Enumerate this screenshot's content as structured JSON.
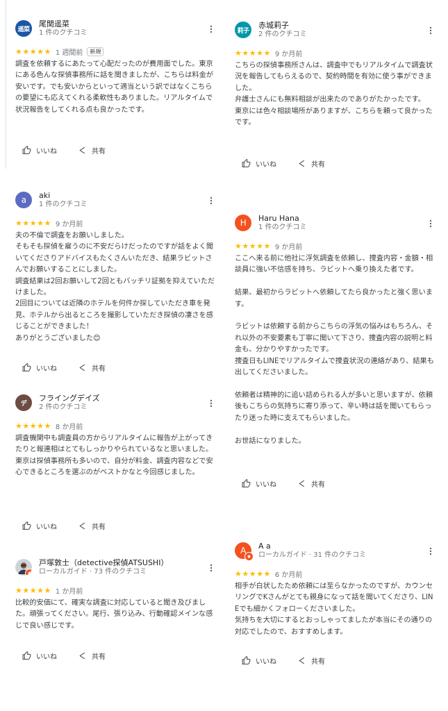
{
  "actions": {
    "like_label": "いいね",
    "share_label": "共有"
  },
  "reviews": [
    {
      "avatar_text": "遥菜",
      "avatar_color": "#1a56a6",
      "name": "尾関遥菜",
      "meta": "1 件のクチコミ",
      "stars": "★★★★★",
      "time": "1 週間前",
      "new_tag": "新規",
      "text": "調査を依頼するにあたって心配だったのが費用面でした。東京にある色んな探偵事務所に話を聞きましたが、こちらは料金が安いです。でも安いからといって適当という訳ではなくこちらの要望にも応えてくれる柔軟性もありました。リアルタイムで状況報告をしてくれる点も良かったです。"
    },
    {
      "avatar_text": "莉子",
      "avatar_color": "#0097a7",
      "name": "赤城莉子",
      "meta": "2 件のクチコミ",
      "stars": "★★★★★",
      "time": "9 か月前",
      "text": "こちらの探偵事務所さんは、調査中でもリアルタイムで調査状況を報告してもらえるので、契約時間を有効に使う事ができました。\n弁護士さんにも無料相談が出来たのでありがたかったです。\n東京には色々相談場所がありますが、こちらを頼って良かったです。"
    },
    {
      "avatar_text": "a",
      "avatar_color": "#5c6bc0",
      "name": "aki",
      "meta": "1 件のクチコミ",
      "stars": "★★★★★",
      "time": "9 か月前",
      "text": "夫の不倫で調査をお願いしました。\nそもそも探偵を雇うのに不安だらけだったのですが話をよく聞いてくださりアドバイスもたくさんいただき、結果ラビットさんでお願いすることにしました。\n調査結果は2回お願いして2回ともバッチリ証拠を抑えていただけました。\n2回目については近隣のホテルを何件か探していただき車を発見、ホテルから出るところを撮影していただき探偵の凄さを感じることができました！\nありがとうございました😊"
    },
    {
      "avatar_text": "H",
      "avatar_color": "#f4511e",
      "name": "Haru Hana",
      "meta": "1 件のクチコミ",
      "stars": "★★★★★",
      "time": "9 か月前",
      "text": "ここへ来る前に他社に浮気調査を依頼し、捜査内容・金額・相談員に強い不信感を持ち、ラビットへ乗り換えた者です。\n\n結果、最初からラビットへ依頼してたら良かったと強く思います。\n\nラビットは依頼する前からこちらの浮気の悩みはもちろん、それ以外の不安要素も丁寧に聞いて下さり、捜査内容の説明と料金も、分かりやすかったです。\n捜査日もLINEでリアルタイムで捜査状況の連絡があり、結果も出してくださいました。\n\n依頼者は精神的に追い詰められる人が多いと思いますが、依頼後もこちらの気持ちに寄り添って、辛い時は話を聞いてもらったり迷った時に支えてもらいました。\n\nお世話になりました。"
    },
    {
      "avatar_text": "デ",
      "avatar_color": "#6d4c41",
      "name": "フライングデイズ",
      "meta": "2 件のクチコミ",
      "stars": "★★★★★",
      "time": "8 か月前",
      "text": "調査機関中も調査員の方からリアルタイムに報告が上がってきたりと報連相はとてもしっかりやられているなと思いました。\n東京は探偵事務所も多いので、自分が料金、調査内容などで安心できるところを選ぶのがベストかなと今回感じました。"
    },
    {
      "avatar_text": "",
      "avatar_color": "#e8eaed",
      "name": "戸塚敦士（detective探偵ATSUSHI）",
      "meta": "ローカルガイド · 73 件のクチコミ",
      "stars": "★★★★★",
      "time": "1 か月前",
      "text": "比較的安価にて、確実な調査に対応していると聞き及びました。頑張ってください。尾行、張り込み、行動確認メインな感じで良い感じです。"
    },
    {
      "avatar_text": "A",
      "avatar_color": "#f4511e",
      "name": "A a",
      "meta": "ローカルガイド · 31 件のクチコミ",
      "stars": "★★★★★",
      "time": "6 か月前",
      "text": "相手が白状したため依頼には至らなかったのですが、カウンセリングでKさんがとても親身になって話を聞いてくださり、LINEでも細かくフォローくださいました。\n気持ちを大切にするとおっしゃってましたが本当にその通りの対応でしたので、おすすめします。"
    }
  ]
}
